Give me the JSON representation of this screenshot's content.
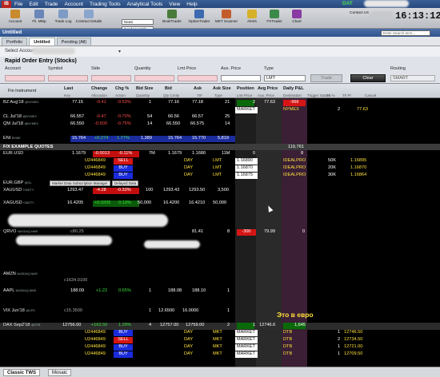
{
  "window": {
    "logo": "IB",
    "menu": [
      "File",
      "Edit",
      "Trade",
      "Account",
      "Trading Tools",
      "Analytical Tools",
      "View",
      "Help"
    ],
    "data_label": "DAT",
    "clock": "16:13:12"
  },
  "toolbar": {
    "buttons": [
      "Account",
      "Fil. Mktp",
      "Trade Log",
      "Contract Details",
      "BookTrader",
      "OptionTrader",
      "MKT Scanner",
      "Alerts",
      "FXTrader",
      "Chart"
    ],
    "dropdowns": [
      "News",
      "Fundamentals"
    ],
    "contact": "Contact Us"
  },
  "workspace": {
    "title": "Untitled",
    "search_placeholder": "Enter Search term...",
    "tabs": [
      "Portfolio",
      "Untitled",
      "Pending (All)"
    ],
    "account_label": "Select Account"
  },
  "order_entry": {
    "title": "Rapid Order Entry (Stocks)",
    "labels": [
      "Account",
      "Symbol",
      "Side",
      "Quantity",
      "Lmt Price",
      "Aux. Price",
      "Type",
      "Routing"
    ],
    "type_value": "LMT",
    "trade_button": "Trade",
    "clear_button": "Clear",
    "routing_value": "SMART"
  },
  "columns": {
    "fin_instrument": "Fin Instrument",
    "top": [
      "Last",
      "Change",
      "Chg %",
      "Bid Size",
      "Bid",
      "Ask",
      "Ask Size",
      "Position",
      "Avg Price",
      "Daily P&L"
    ],
    "sub": [
      "Key",
      "Allocation",
      "Action",
      "Quantity",
      "Qty Cmity",
      "TIF",
      "Type",
      "Lmt Price",
      "Aux. Price",
      "Destination",
      "Trigger Status",
      "Trl %",
      "Trl Pr",
      "Cancel"
    ]
  },
  "rows": {
    "bz": {
      "sym": "BZ Aug'18",
      "exch": "@NYMEX",
      "last": "77.15",
      "chg": "-0.41",
      "pct": "-0.53%",
      "bidsz": "1",
      "bid": "77.16",
      "ask": "77.18",
      "asksz": "21",
      "pos": "2",
      "avg": "77.63",
      "pnl": "-966"
    },
    "bz_order": {
      "type": "MARKET",
      "dest": "NYMEX",
      "qty": "2",
      "price": "77.63"
    },
    "cl": {
      "sym": "CL Jul'18",
      "exch": "@NYMEX",
      "last": "66.557",
      "chg": "-0.47",
      "pct": "-0.70%",
      "bidsz": "54",
      "bid": "66.56",
      "ask": "66.57",
      "asksz": "25"
    },
    "qm": {
      "sym": "QM Jul'18",
      "exch": "@NYMEX",
      "last": "66.550",
      "chg": "-0.500",
      "pct": "-0.75%",
      "bidsz": "14",
      "bid": "66.550",
      "ask": "66.575",
      "asksz": "14"
    },
    "eni": {
      "sym": "ENI",
      "exch": "BVME",
      "last": "15.764",
      "chg": "+0.274",
      "pct": "1.77%",
      "bidsz": "1,389",
      "bid": "15.764",
      "ask": "15.770",
      "asksz": "5,819"
    },
    "fx_section": {
      "title": "F/X EXAMPLE QUOTES",
      "pnl": "119,761"
    },
    "eurusd": {
      "sym": "EUR.USD",
      "last": "1.1679",
      "chg": "-0.0013",
      "pct": "-0.11%",
      "bidsz": "7M",
      "bid": "1.1679",
      "ask": "1.1680",
      "asksz": "11M",
      "pos": "0",
      "pnl": "8"
    },
    "eur_orders": [
      {
        "key": "U2446849",
        "action": "SELL",
        "tif": "DAY",
        "type": "LMT",
        "lmt": "1.16890",
        "dest": "IDEALPRO",
        "qty": "50K",
        "price": "1.16895"
      },
      {
        "key": "U2446849",
        "action": "BUY",
        "tif": "DAY",
        "type": "LMT",
        "lmt": "1.16870",
        "dest": "IDEALPRO",
        "qty": "20K",
        "price": "1.16870"
      },
      {
        "key": "U2446849",
        "action": "BUY",
        "tif": "DAY",
        "type": "LMT",
        "lmt": "1.16875",
        "dest": "IDEALPRO",
        "qty": "30K",
        "price": "1.16864"
      }
    ],
    "eurgbp": {
      "sym": "EUR.GBP",
      "exch": "@GL",
      "tag1": "Market Data Subscription Manager",
      "tag2": "Delayed Data"
    },
    "xauusd": {
      "sym": "XAUUSD",
      "exch": "CMDTY",
      "last": "1293.47",
      "chg": "-4.28",
      "pct": "-0.33%",
      "bidsz": "100",
      "bid": "1293.43",
      "ask": "1293.50",
      "asksz": "3,500"
    },
    "xagusd": {
      "sym": "XAGUSD",
      "exch": "CMDTY",
      "last": "16.4205",
      "chg": "+0.0205",
      "pct": "0.13%",
      "bidsz": "50,000",
      "bid": "16.4200",
      "ask": "16.4210",
      "asksz": "50,000"
    },
    "qrvo": {
      "sym": "QRVO",
      "exch": "NASDAQ.NMS",
      "last": "c80.25",
      "ask": "81.41",
      "asksz": "8",
      "pos": "-300",
      "avg": "79.99",
      "pnl": "0"
    },
    "amzn": {
      "sym": "AMZN",
      "exch": "NASDAQ.NMS",
      "last": "c1634.0100"
    },
    "aapl": {
      "sym": "AAPL",
      "exch": "NASDAQ.NMS",
      "last": "188.09",
      "chg": "+1.22",
      "pct": "0.65%",
      "bidsz": "1",
      "bid": "188.08",
      "ask": "188.10",
      "asksz": "1"
    },
    "vix": {
      "sym": "VIX Jun'18",
      "exch": "@CFE",
      "last": "c15.3500",
      "bidsz": "1",
      "bid": "12.6500",
      "ask": "16.0000",
      "asksz": "1"
    },
    "dax": {
      "sym": "DAX Sep2'18",
      "exch": "@DTB",
      "last": "12756.00",
      "chg": "+162.50",
      "pct": "1.29%",
      "bidsz": "4",
      "bid": "12757.00",
      "ask": "12759.00",
      "asksz": "2",
      "pos": "1",
      "avg": "12746.6",
      "pnl": "1,645"
    },
    "dax_orders": [
      {
        "key": "U2446849",
        "action": "BUY",
        "tif": "DAY",
        "type": "MKT",
        "order": "MARKET",
        "dest": "DTB",
        "qty": "1",
        "price": "12746.50"
      },
      {
        "key": "U2446849",
        "action": "SELL",
        "tif": "DAY",
        "type": "MKT",
        "order": "MARKET",
        "dest": "DTB",
        "qty": "2",
        "price": "12734.50"
      },
      {
        "key": "U2446849",
        "action": "BUY",
        "tif": "DAY",
        "type": "MKT",
        "order": "MARKET",
        "dest": "DTB",
        "qty": "1",
        "price": "12721.00"
      },
      {
        "key": "U2446849",
        "action": "BUY",
        "tif": "DAY",
        "type": "MKT",
        "order": "MARKET",
        "dest": "DTB",
        "qty": "1",
        "price": "12709.50"
      }
    ]
  },
  "annotation": "Это в евро",
  "status_tabs": [
    "Classic TWS",
    "Mosaic"
  ],
  "colors": {
    "sell": "#d61515",
    "buy": "#1a2bdc",
    "positive": "#3be03b",
    "negative": "#ff4d4d",
    "key": "#ffe23a"
  }
}
